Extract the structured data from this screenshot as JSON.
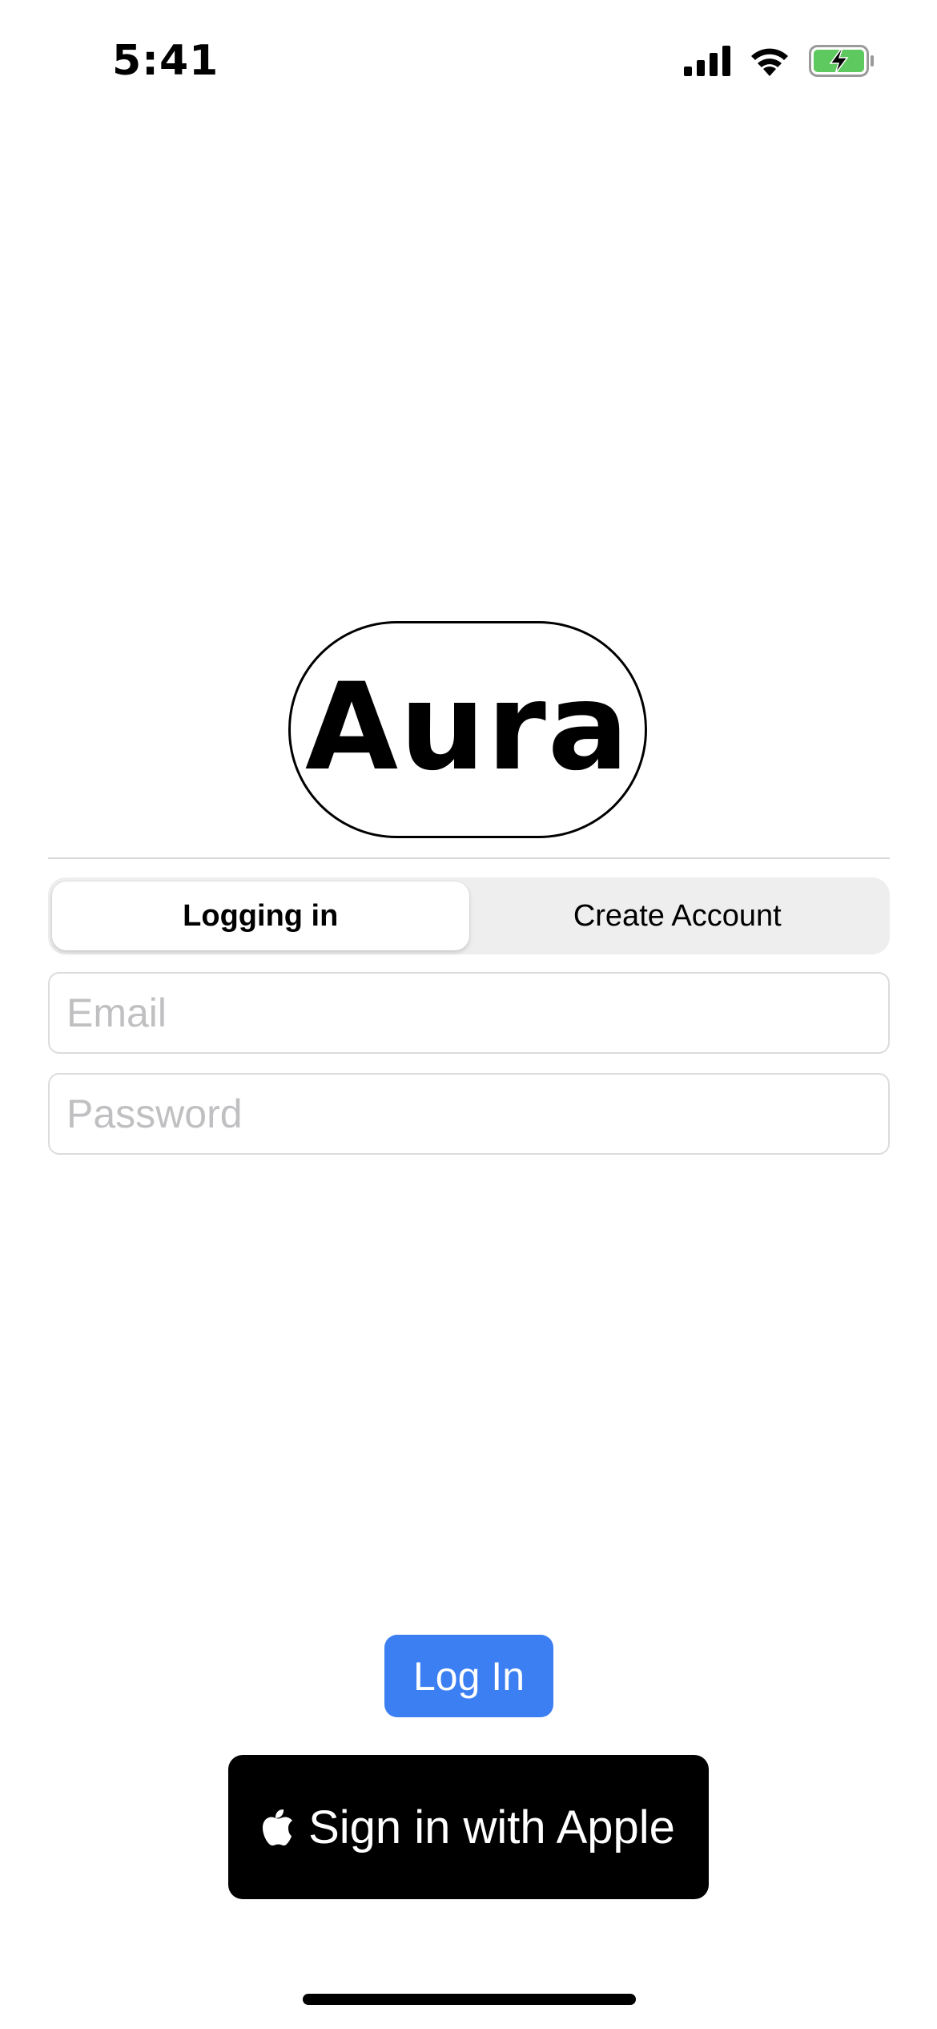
{
  "status_bar": {
    "time": "5:41",
    "icons": [
      "cellular-signal-icon",
      "wifi-icon",
      "battery-charging-icon"
    ],
    "battery_color": "#5ec95e"
  },
  "logo": {
    "text": "Aura"
  },
  "auth_mode": {
    "segments": [
      {
        "label": "Logging in",
        "selected": true
      },
      {
        "label": "Create Account",
        "selected": false
      }
    ]
  },
  "form": {
    "email": {
      "value": "",
      "placeholder": "Email"
    },
    "password": {
      "value": "",
      "placeholder": "Password"
    }
  },
  "actions": {
    "login_label": "Log In",
    "login_color": "#3b7ff2",
    "apple_label": "Sign in with Apple",
    "apple_icon": "apple-logo-icon"
  }
}
